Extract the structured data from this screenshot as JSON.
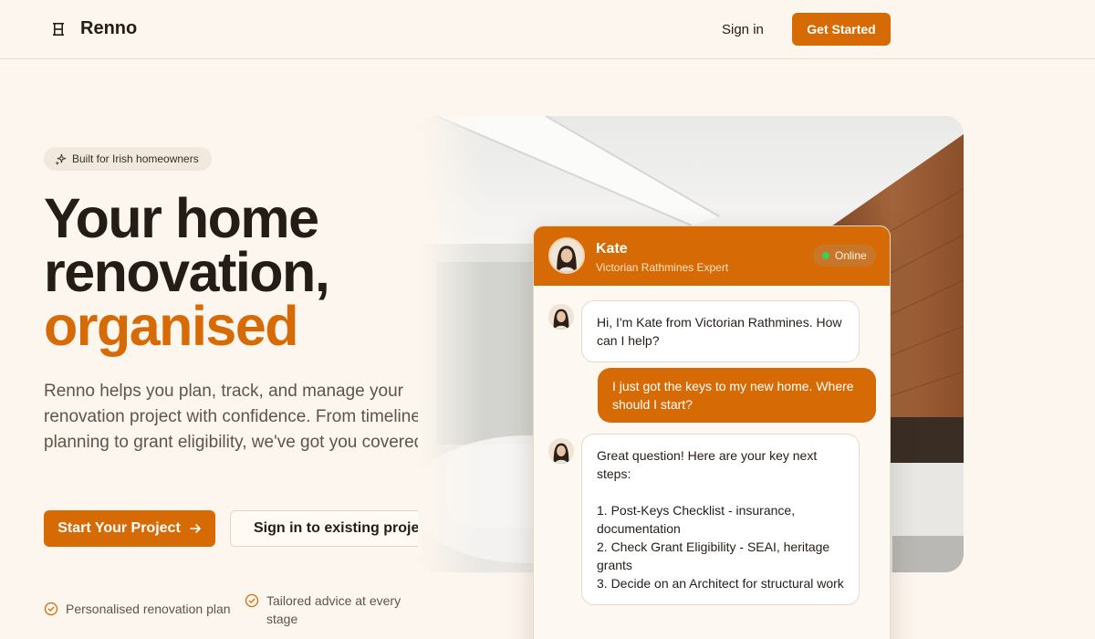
{
  "brand": {
    "name": "Renno"
  },
  "nav": {
    "signin": "Sign in",
    "get_started": "Get Started"
  },
  "hero": {
    "badge": "Built for Irish homeowners",
    "title_line1": "Your home",
    "title_line2": "renovation,",
    "title_accent": "organised",
    "description": "Renno helps you plan, track, and manage your renovation project with confidence. From timeline planning to grant eligibility, we've got you covered.",
    "primary_cta": "Start Your Project",
    "secondary_cta": "Sign in to existing project",
    "features": [
      "Personalised renovation plan",
      "Tailored advice at every stage"
    ]
  },
  "chat": {
    "agent_name": "Kate",
    "agent_role": "Victorian Rathmines Expert",
    "status": "Online",
    "messages": [
      {
        "from": "agent",
        "text": "Hi, I'm Kate from Victorian Rathmines. How can I help?"
      },
      {
        "from": "user",
        "text": "I just got the keys to my new home. Where should I start?"
      },
      {
        "from": "agent",
        "text": "Great question! Here are your key next steps:\n\n1. Post-Keys Checklist - insurance, documentation\n2. Check Grant Eligibility - SEAI, heritage grants\n3. Decide on an Architect for structural work"
      }
    ]
  },
  "colors": {
    "accent": "#d66b06",
    "background": "#fdf6ee",
    "text": "#241d17",
    "online": "#3ccf54"
  }
}
